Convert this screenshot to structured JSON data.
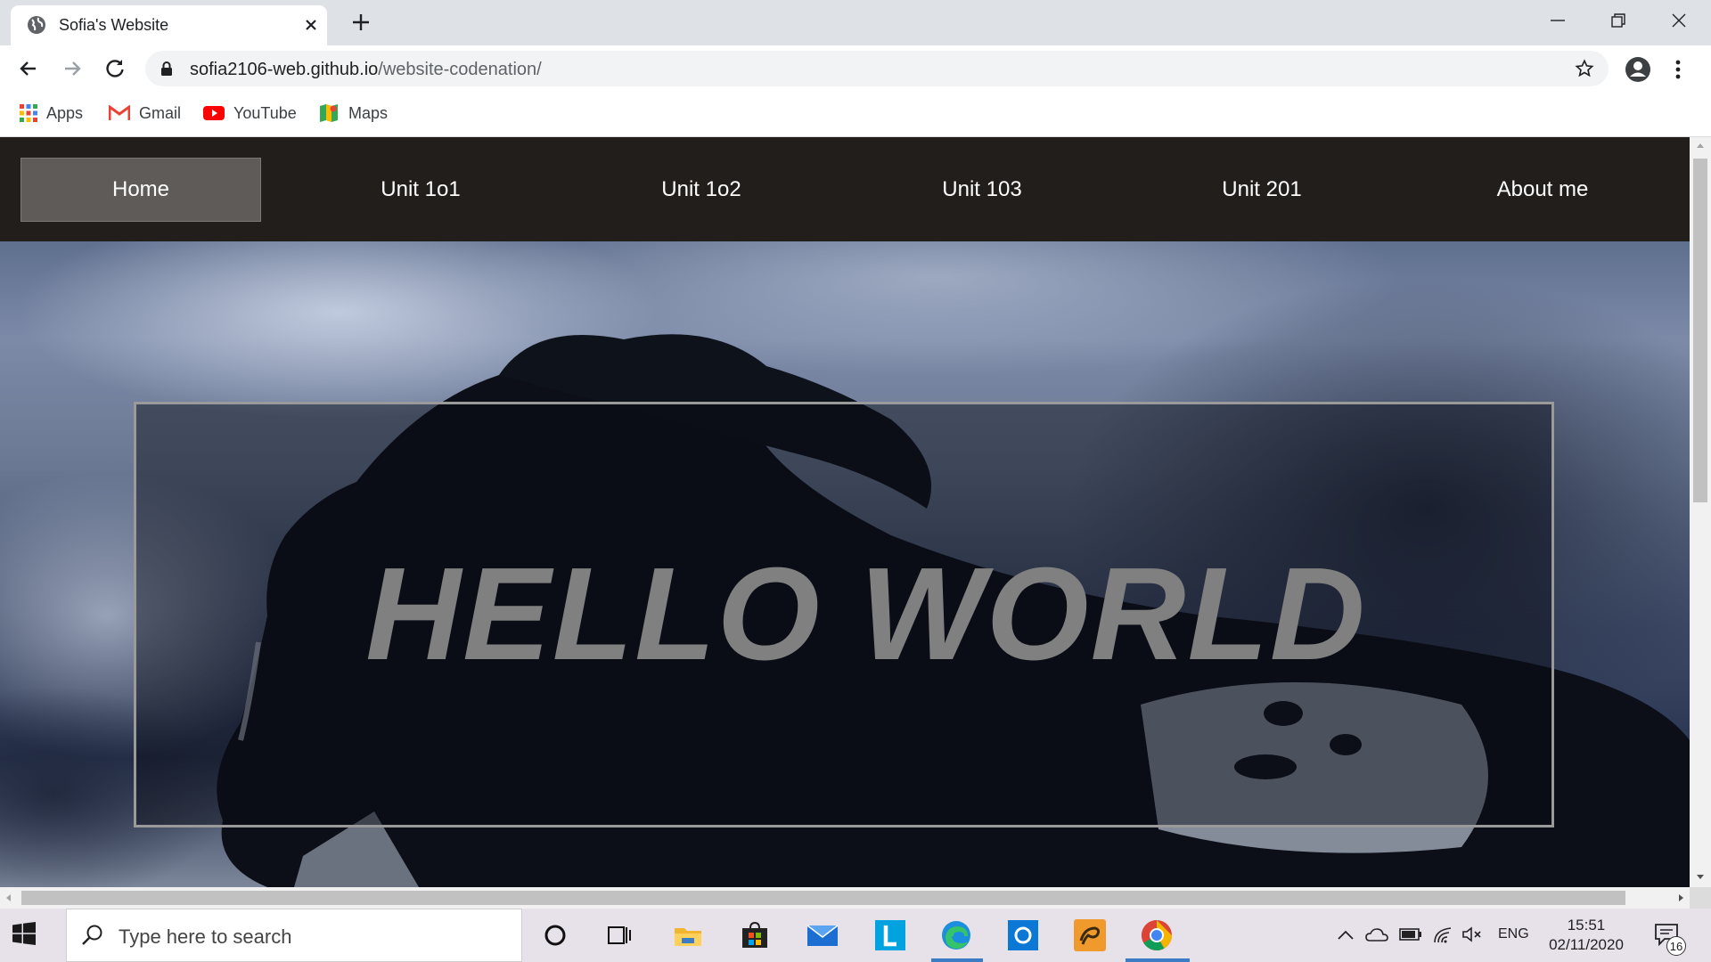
{
  "browser": {
    "tab_title": "Sofia's Website",
    "url_host": "sofia2106-web.github.io",
    "url_path": "/website-codenation/",
    "bookmarks": [
      "Apps",
      "Gmail",
      "YouTube",
      "Maps"
    ]
  },
  "site": {
    "nav": [
      "Home",
      "Unit 1o1",
      "Unit 1o2",
      "Unit 103",
      "Unit 201",
      "About me"
    ],
    "active_nav": "Home",
    "hero_text": "HELLO WORLD"
  },
  "taskbar": {
    "search_placeholder": "Type here to search",
    "language": "ENG",
    "time": "15:51",
    "date": "02/11/2020",
    "notification_count": "16",
    "pinned_apps": [
      "cortana-icon",
      "task-view-icon",
      "file-explorer-icon",
      "microsoft-store-icon",
      "mail-icon",
      "l-app-icon",
      "edge-icon",
      "outlook-icon",
      "paint-app-icon",
      "chrome-icon"
    ]
  },
  "colors": {
    "site_nav_bg": "#221e1c",
    "active_nav_bg": "#5f5b58",
    "hero_text": "#808080"
  }
}
